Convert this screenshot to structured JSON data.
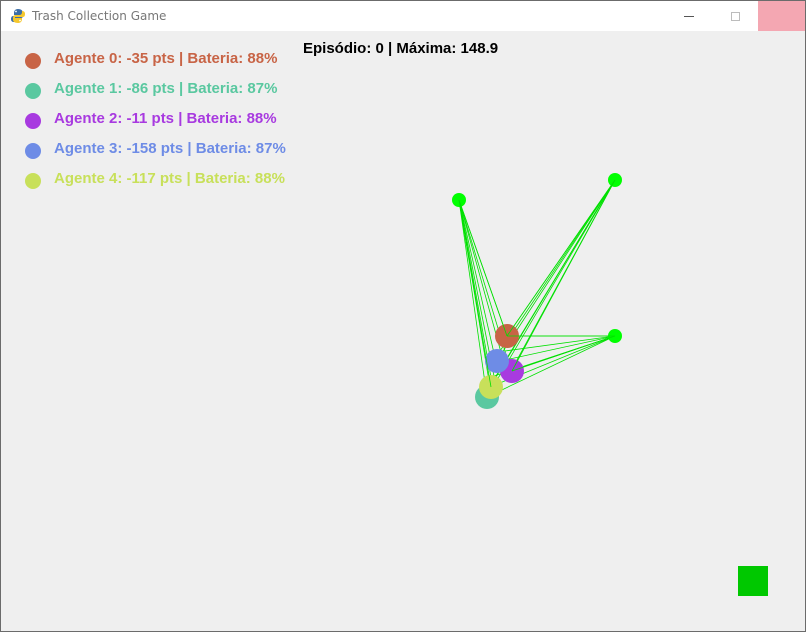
{
  "window": {
    "title": "Trash Collection Game",
    "icon": "pygame-snake-icon",
    "controls": [
      "minimize",
      "maximize",
      "close"
    ]
  },
  "header": {
    "text": "Episódio: 0 | Máxima: 148.9"
  },
  "agents": [
    {
      "label": "Agente 0: -35 pts | Bateria: 88%",
      "color": "#c86446"
    },
    {
      "label": "Agente 1: -86 pts | Bateria: 87%",
      "color": "#5ac8a0"
    },
    {
      "label": "Agente 2: -11 pts | Bateria: 88%",
      "color": "#a83ae0"
    },
    {
      "label": "Agente 3: -158 pts | Bateria: 87%",
      "color": "#6e8ce6"
    },
    {
      "label": "Agente 4: -117 pts | Bateria: 88%",
      "color": "#c8e05a"
    }
  ],
  "scene": {
    "trash_color": "#00ff00",
    "line_color": "#00e000",
    "base_color": "#00c800"
  }
}
